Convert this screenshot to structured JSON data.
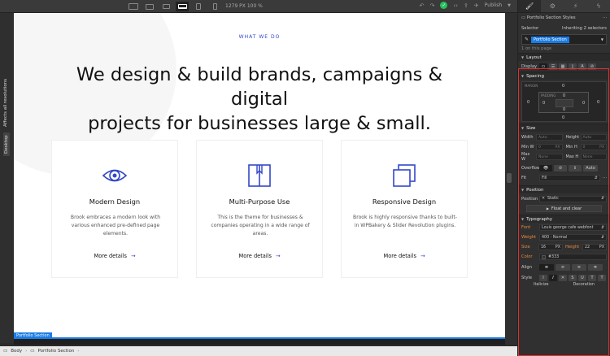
{
  "toolbar": {
    "devices": [
      "desktop-large",
      "desktop",
      "laptop",
      "tablet",
      "mobile-landscape",
      "mobile"
    ],
    "active_device_index": 3,
    "dimensions_text": "1279 PX  100 %",
    "publish_label": "Publish"
  },
  "left_strip": {
    "affects_label": "Affects all resolutions",
    "device_label": "Desktop"
  },
  "canvas": {
    "eyebrow": "WHAT WE DO",
    "headline_line1": "We design & build brands, campaigns & digital",
    "headline_line2": "projects for businesses large & small.",
    "accent_color": "#3348c9",
    "cards": [
      {
        "icon": "eye-icon",
        "title": "Modern Design",
        "desc": "Brook embraces a modern look with various enhanced pre-defined page elements.",
        "link": "More details"
      },
      {
        "icon": "book-icon",
        "title": "Multi-Purpose Use",
        "desc": "This is the theme for businesses & companies operating in a wide range of areas.",
        "link": "More details"
      },
      {
        "icon": "squares-icon",
        "title": "Responsive Design",
        "desc": "Brook is highly responsive thanks to built-in WPBakery & Slider Revolution plugins.",
        "link": "More details"
      }
    ],
    "section_tag": "Portfolio Section"
  },
  "breadcrumb": {
    "items": [
      "Body",
      "Portfolio Section"
    ]
  },
  "panel": {
    "header": "Portfolio Section Styles",
    "selector_label": "Selector",
    "inheriting_text": "Inheriting 2 selectors",
    "selector_chip": "Portfolio Section",
    "on_page": "1 on this page",
    "layout": {
      "title": "Layout",
      "display_label": "Display"
    },
    "spacing": {
      "title": "Spacing",
      "margin_label": "MARGIN",
      "padding_label": "PADDING",
      "margin_top": "0",
      "margin_right": "0",
      "margin_bottom": "0",
      "margin_left": "0",
      "padding_top": "0",
      "padding_right": "0",
      "padding_bottom": "0",
      "padding_left": "0"
    },
    "size": {
      "title": "Size",
      "width_label": "Width",
      "width_value": "Auto",
      "height_label": "Height",
      "height_value": "Auto",
      "minw_label": "Min W",
      "minw_value": "0",
      "minw_unit": "PX",
      "minh_label": "Min H",
      "minh_value": "0",
      "minh_unit": "PX",
      "maxw_label": "Max W",
      "maxw_value": "None",
      "maxh_label": "Max H",
      "maxh_value": "None",
      "overflow_label": "Overflow",
      "overflow_auto": "Auto",
      "fit_label": "Fit",
      "fit_value": "Fill"
    },
    "position": {
      "title": "Position",
      "position_label": "Position",
      "position_value": "Static",
      "float_label": "Float and clear"
    },
    "typography": {
      "title": "Typography",
      "font_label": "Font",
      "font_value": "Louis george cafe webfont",
      "weight_label": "Weight",
      "weight_value": "400 - Normal",
      "size_label": "Size",
      "size_value": "16",
      "size_unit": "PX",
      "height_label": "Height",
      "height_value": "22",
      "height_unit": "PX",
      "color_label": "Color",
      "color_value": "#333",
      "align_label": "Align",
      "style_label": "Style",
      "italicize_label": "Italicize",
      "decoration_label": "Decoration"
    }
  }
}
